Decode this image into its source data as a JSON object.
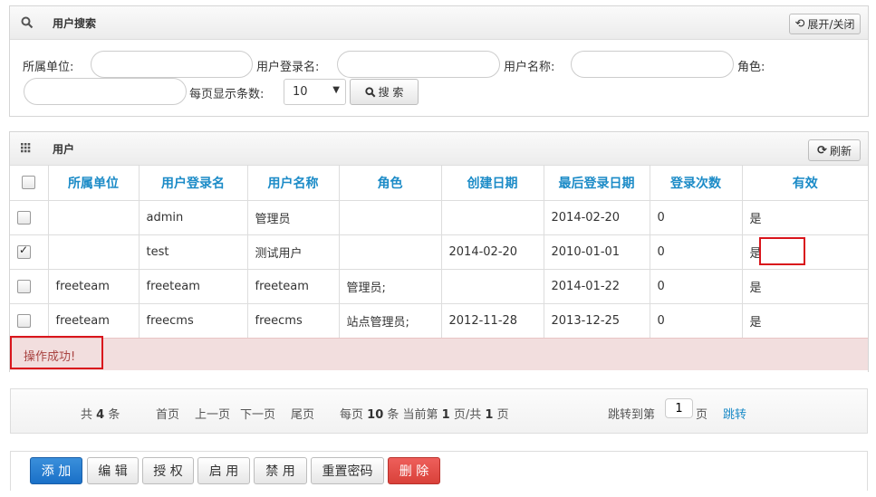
{
  "search_panel": {
    "title": "用户搜索",
    "toggle_label": "展开/关闭",
    "fields": {
      "unit_label": "所属单位:",
      "login_label": "用户登录名:",
      "name_label": "用户名称:",
      "role_label": "角色:",
      "page_size_label": "每页显示条数:",
      "page_size_value": "10"
    },
    "search_label": "搜 索"
  },
  "user_panel": {
    "title": "用户",
    "refresh_label": "刷新"
  },
  "table": {
    "headers": [
      "所属单位",
      "用户登录名",
      "用户名称",
      "角色",
      "创建日期",
      "最后登录日期",
      "登录次数",
      "有效"
    ],
    "rows": [
      {
        "checked": false,
        "unit": "",
        "login": "admin",
        "name": "管理员",
        "role": "",
        "created": "",
        "last_login": "2014-02-20",
        "count": "0",
        "valid": "是"
      },
      {
        "checked": true,
        "unit": "",
        "login": "test",
        "name": "测试用户",
        "role": "",
        "created": "2014-02-20",
        "last_login": "2010-01-01",
        "count": "0",
        "valid": "是"
      },
      {
        "checked": false,
        "unit": "freeteam",
        "login": "freeteam",
        "name": "freeteam",
        "role": "管理员;",
        "created": "",
        "last_login": "2014-01-22",
        "count": "0",
        "valid": "是"
      },
      {
        "checked": false,
        "unit": "freeteam",
        "login": "freecms",
        "name": "freecms",
        "role": "站点管理员;",
        "created": "2012-11-28",
        "last_login": "2013-12-25",
        "count": "0",
        "valid": "是"
      }
    ]
  },
  "message": "操作成功!",
  "pager": {
    "total_prefix": "共",
    "total": "4",
    "total_suffix": "条",
    "first": "首页",
    "prev": "上一页",
    "next": "下一页",
    "last": "尾页",
    "per_page_prefix": "每页",
    "per_page": "10",
    "per_page_mid": "条 当前第",
    "current": "1",
    "pages_mid": "页/共",
    "pages": "1",
    "pages_suffix": "页",
    "jump_prefix": "跳转到第",
    "jump_value": "1",
    "jump_suffix": "页",
    "jump_button": "跳转"
  },
  "actions": {
    "add": "添 加",
    "edit": "编 辑",
    "grant": "授 权",
    "enable": "启 用",
    "disable": "禁 用",
    "reset_password": "重置密码",
    "delete": "删 除"
  },
  "colors": {
    "header_text": "#1b8bc7",
    "primary_button": "#1a70c7",
    "danger_button": "#d9413a",
    "alert_bg": "#f2dede",
    "highlight_box": "#d9151c"
  }
}
